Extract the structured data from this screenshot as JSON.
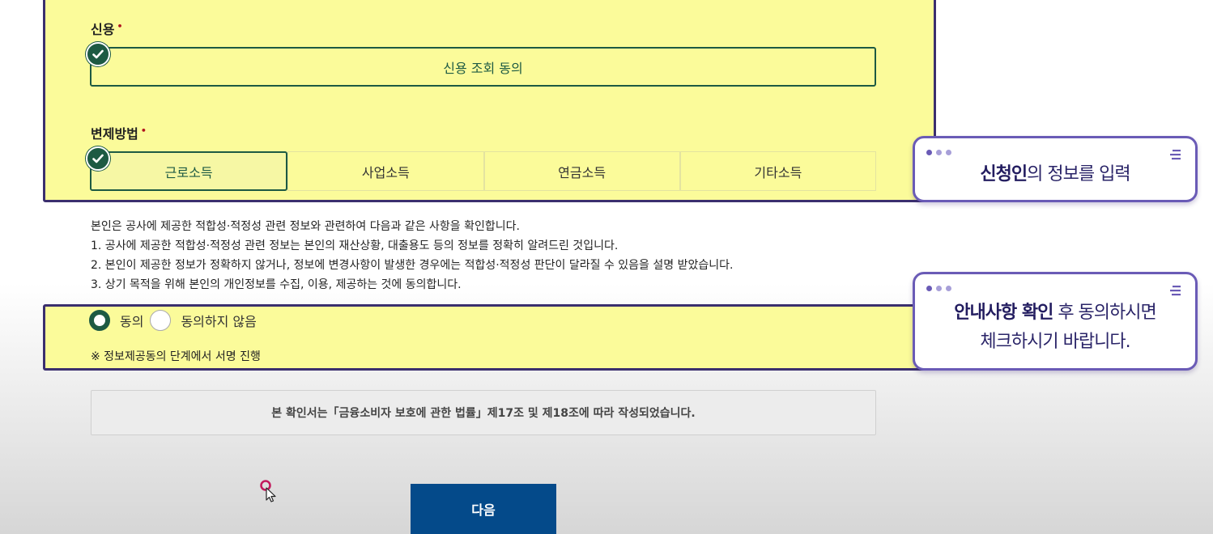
{
  "credit": {
    "label": "신용",
    "required_mark": "•",
    "button_label": "신용 조회 동의"
  },
  "repayment": {
    "label": "변제방법",
    "required_mark": "•",
    "options": [
      "근로소득",
      "사업소득",
      "연금소득",
      "기타소득"
    ],
    "selected": "근로소득"
  },
  "notice": {
    "lines": [
      "본인은 공사에 제공한 적합성·적정성 관련 정보와 관련하여 다음과 같은 사항을 확인합니다.",
      "1. 공사에 제공한 적합성·적정성 관련 정보는 본인의 재산상황, 대출용도 등의 정보를 정확히 알려드린 것입니다.",
      "2. 본인이 제공한 정보가 정확하지 않거나, 정보에 변경사항이 발생한 경우에는 적합성·적정성 판단이 달라질 수 있음을 설명 받았습니다.",
      "3. 상기 목적을 위해 본인의 개인정보를 수집, 이용, 제공하는 것에 동의합니다."
    ]
  },
  "consent": {
    "agree_label": "동의",
    "disagree_label": "동의하지 않음",
    "selected": "동의",
    "sign_note": "※ 정보제공동의 단계에서 서명 진행"
  },
  "law_notice": "본 확인서는「금융소비자 보호에 관한 법률」제17조 및 제18조에 따라 작성되었습니다.",
  "next_button": "다음",
  "tooltips": {
    "tip1": {
      "bold": "신청인",
      "rest": "의 정보를 입력"
    },
    "tip2": {
      "bold": "안내사항 확인",
      "rest": " 후 동의하시면",
      "line2": "체크하시기 바랍니다."
    }
  },
  "colors": {
    "highlight_bg": "#fbfb9a",
    "highlight_border": "#3b2f6e",
    "accent_green": "#1d5a43",
    "next_button": "#044a8a",
    "tooltip_border": "#6a5bb6"
  }
}
